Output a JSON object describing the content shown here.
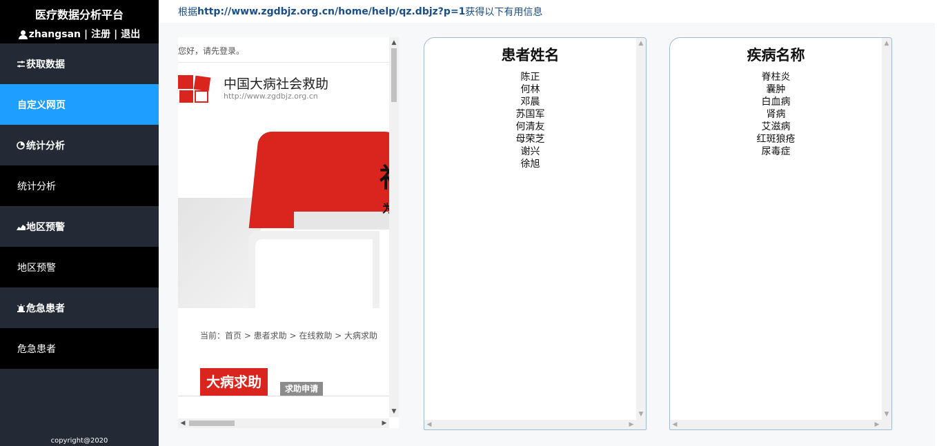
{
  "sidebar": {
    "title": "医疗数据分析平台",
    "user": "zhangsan",
    "register": "注册",
    "logout": "退出",
    "separator": "|",
    "menu": [
      {
        "label": "获取数据",
        "type": "group",
        "icon": "settings-icon"
      },
      {
        "label": "自定义网页",
        "type": "active"
      },
      {
        "label": "统计分析",
        "type": "group",
        "icon": "pie-chart-icon"
      },
      {
        "label": "统计分析",
        "type": "sub"
      },
      {
        "label": "地区预警",
        "type": "group",
        "icon": "area-chart-icon"
      },
      {
        "label": "地区预警",
        "type": "sub"
      },
      {
        "label": "危急患者",
        "type": "group",
        "icon": "alarm-icon"
      },
      {
        "label": "危急患者",
        "type": "sub"
      }
    ],
    "copyright": "copyright@2020"
  },
  "header": {
    "prefix": "根据",
    "url": "http://www.zgdbjz.org.cn/home/help/qz.dbjz?p=1",
    "suffix": "获得以下有用信息"
  },
  "webframe": {
    "greeting": "您好，请先登录。",
    "site_name": "中国大病社会救助",
    "site_url": "http://www.zgdbjz.org.cn",
    "breadcrumb": "当前：首页 > 患者求助 > 在线救助 > 大病求助",
    "page_title": "大病求助",
    "tab_label": "求助申请",
    "banner_char": "社",
    "banner_char2": "为"
  },
  "patients": {
    "title": "患者姓名",
    "items": [
      "陈正",
      "何林",
      "邓晨",
      "苏国军",
      "何清友",
      "母荣芝",
      "谢兴",
      "徐旭"
    ]
  },
  "diseases": {
    "title": "疾病名称",
    "items": [
      "脊柱炎",
      "囊肿",
      "白血病",
      "肾病",
      "艾滋病",
      "红斑狼疮",
      "尿毒症"
    ]
  },
  "colors": {
    "sidebar_bg": "#232a35",
    "active_bg": "#1e9fff",
    "brand_red": "#d9251d",
    "link_blue": "#1a4e8a"
  }
}
